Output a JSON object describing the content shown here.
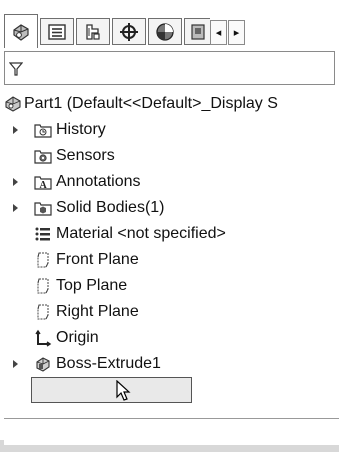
{
  "tabs": [
    {
      "name": "featuremanager-tab",
      "icon": "featuremanager-icon",
      "active": true
    },
    {
      "name": "propertymanager-tab",
      "icon": "propertymanager-icon",
      "active": false
    },
    {
      "name": "configurationmanager-tab",
      "icon": "configurationmanager-icon",
      "active": false
    },
    {
      "name": "dimxpertmanager-tab",
      "icon": "dimxpert-icon",
      "active": false
    },
    {
      "name": "displaymanager-tab",
      "icon": "displaymanager-icon",
      "active": false
    },
    {
      "name": "cammanager-tab",
      "icon": "cam-icon",
      "active": false
    }
  ],
  "scroll": {
    "left": "◂",
    "right": "▸"
  },
  "filter": {
    "icon": "filter-icon",
    "value": ""
  },
  "tree": {
    "root": {
      "label": "Part1  (Default<<Default>_Display S",
      "icon": "part-icon"
    },
    "items": [
      {
        "label": "History",
        "icon": "history-folder-icon",
        "expandable": true
      },
      {
        "label": "Sensors",
        "icon": "sensors-folder-icon",
        "expandable": false
      },
      {
        "label": "Annotations",
        "icon": "annotations-folder-icon",
        "expandable": true
      },
      {
        "label": "Solid Bodies(1)",
        "icon": "solid-bodies-folder-icon",
        "expandable": true
      },
      {
        "label": "Material <not specified>",
        "icon": "material-icon",
        "expandable": false
      },
      {
        "label": "Front Plane",
        "icon": "plane-icon",
        "expandable": false
      },
      {
        "label": "Top Plane",
        "icon": "plane-icon",
        "expandable": false
      },
      {
        "label": "Right Plane",
        "icon": "plane-icon",
        "expandable": false
      },
      {
        "label": "Origin",
        "icon": "origin-icon",
        "expandable": false
      },
      {
        "label": "Boss-Extrude1",
        "icon": "boss-extrude-icon",
        "expandable": true,
        "selected": true
      }
    ]
  },
  "colors": {
    "selected_bg": "#e9e9e9",
    "border": "#6f6f6f",
    "shadow": "#d8d8d8"
  }
}
